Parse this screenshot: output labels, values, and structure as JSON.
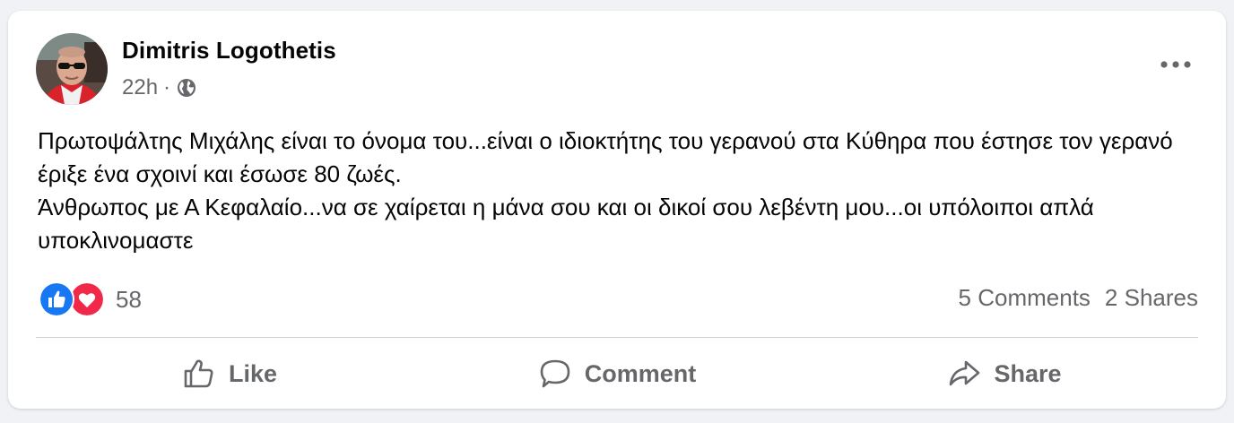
{
  "post": {
    "author": "Dimitris Logothetis",
    "time": "22h",
    "separator": "·",
    "audience_icon": "globe-icon",
    "menu_icon": "more-options-icon",
    "text_lines": [
      "Πρωτοψάλτης Μιχάλης είναι το όνομα του...είναι ο ιδιοκτήτης του γερανού στα Κύθηρα που έστησε τον γερανό έριξε ένα σχοινί και έσωσε 80 ζωές.",
      "Άνθρωπος με Α Κεφαλαίο...να σε χαίρεται η μάνα σου και οι δικοί σου λεβέντη μου...οι υπόλοιποι απλά υποκλινομαστε"
    ]
  },
  "reactions": {
    "types": [
      "like-reaction-icon",
      "love-reaction-icon"
    ],
    "count": "58"
  },
  "stats": {
    "comments": "5 Comments",
    "shares": "2 Shares"
  },
  "actions": {
    "like": "Like",
    "comment": "Comment",
    "share": "Share"
  },
  "colors": {
    "background": "#f0f2f5",
    "card": "#ffffff",
    "text": "#050505",
    "secondary_text": "#65676b",
    "like_blue": "#1877f2",
    "love_red": "#f02849"
  }
}
